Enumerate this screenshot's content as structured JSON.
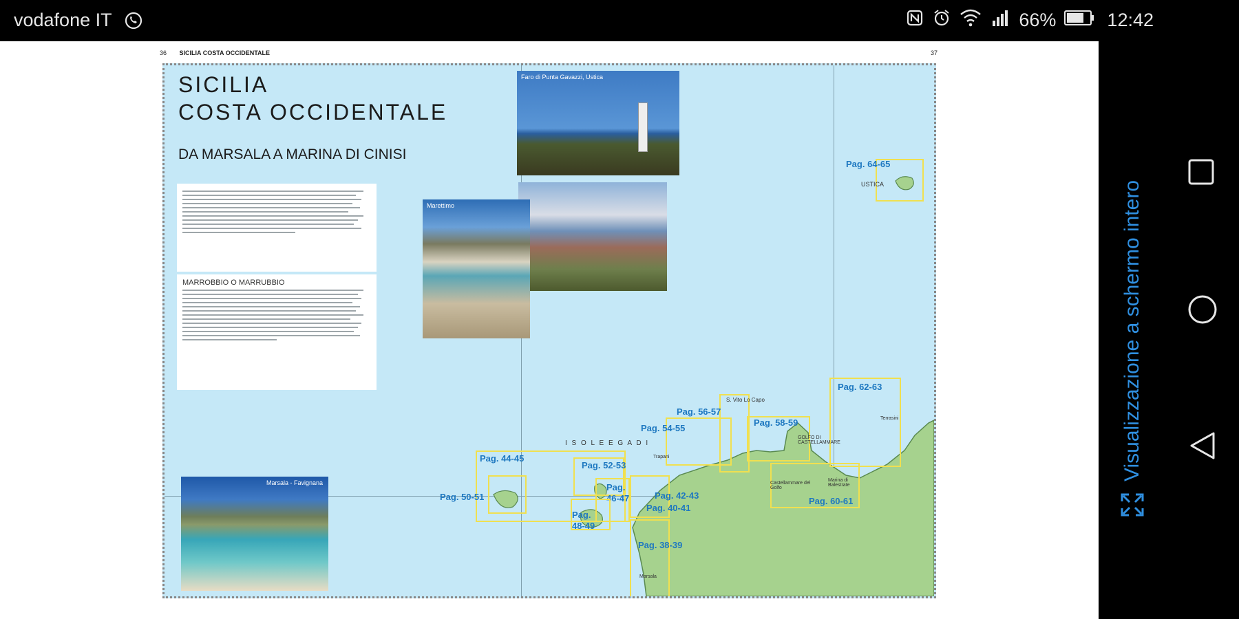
{
  "status": {
    "carrier": "vodafone IT",
    "battery": "66%",
    "time": "12:42",
    "icons": [
      "whatsapp-icon",
      "nfc-icon",
      "alarm-icon",
      "wifi-icon",
      "signal-icon",
      "battery-icon"
    ]
  },
  "fullscreen": {
    "label": "Visualizzazione a schermo intero",
    "icon": "expand-icon"
  },
  "nav": [
    "recents-button",
    "home-button",
    "back-button"
  ],
  "page": {
    "left_num": "36",
    "header": "SICILIA COSTA OCCIDENTALE",
    "right_num": "37",
    "title_line1": "SICILIA",
    "title_line2": "COSTA OCCIDENTALE",
    "subtitle": "DA MARSALA A MARINA DI CINISI",
    "box2_head": "MARROBBIO O MARRUBBIO"
  },
  "photos": {
    "lighthouse": "Faro di Punta Gavazzi, Ustica",
    "marettimo": "Marettimo",
    "favignana": "Marsala - Favignana"
  },
  "map_labels": {
    "egadi": "I S O L E   E G A D I",
    "ustica": "USTICA",
    "p64": "Pag. 64-65",
    "p62": "Pag. 62-63",
    "p56": "Pag. 56-57",
    "p58": "Pag. 58-59",
    "p54": "Pag. 54-55",
    "p44": "Pag. 44-45",
    "p52": "Pag. 52-53",
    "p46": "Pag. 46-47",
    "p50": "Pag. 50-51",
    "p48": "Pag. 48-49",
    "p42": "Pag. 42-43",
    "p40": "Pag. 40-41",
    "p38": "Pag. 38-39",
    "p60": "Pag. 60-61",
    "sanvito": "S. Vito Lo Capo",
    "golfo": "GOLFO DI CASTELLAMMARE",
    "castellammare": "Castellammare del Golfo",
    "balestrate": "Marina di Balestrate",
    "terrasini": "Terrasini",
    "marsala": "Marsala",
    "trapani": "Trapani"
  },
  "colors": {
    "sea": "#c5e8f7",
    "land": "#a6d28e",
    "highlight": "#1e78c0",
    "box": "#f0e050"
  }
}
